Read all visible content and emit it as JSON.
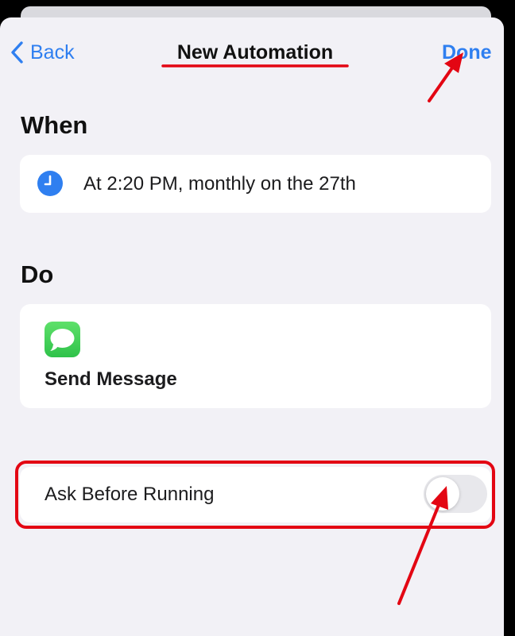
{
  "nav": {
    "back_label": "Back",
    "title": "New Automation",
    "done_label": "Done"
  },
  "when": {
    "section_title": "When",
    "trigger_text": "At 2:20 PM, monthly on the 27th",
    "icon": "clock-icon"
  },
  "do": {
    "section_title": "Do",
    "action_label": "Send Message",
    "icon": "messages-icon"
  },
  "settings": {
    "ask_before_running_label": "Ask Before Running",
    "ask_before_running_enabled": false
  },
  "colors": {
    "accent": "#2f7ff0",
    "background": "#f2f1f6",
    "card": "#ffffff",
    "annotation": "#e30613",
    "messages_green": "#34c759"
  }
}
